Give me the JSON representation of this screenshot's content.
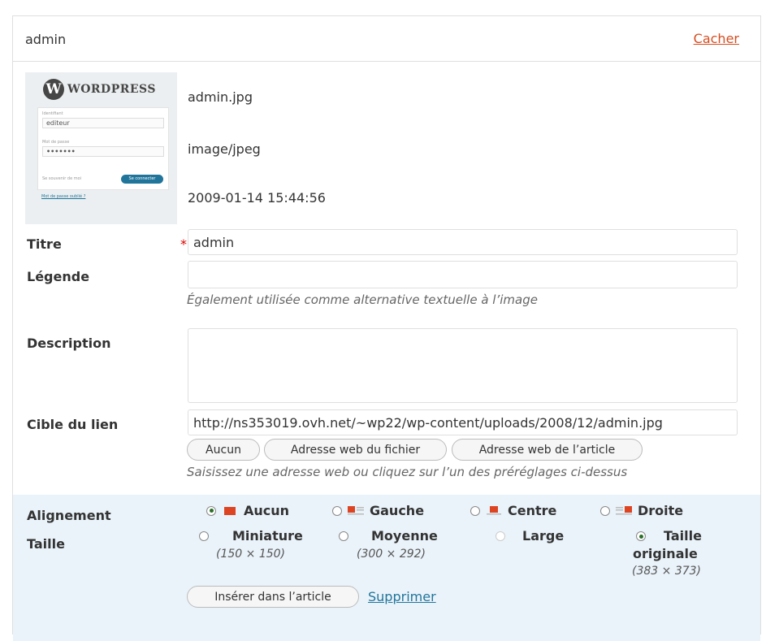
{
  "header": {
    "name": "admin",
    "hide_link": "Cacher"
  },
  "thumbnail": {
    "logo_text": "WordPress",
    "field1_label": "Identifiant",
    "field1_value": "editeur",
    "field2_label": "Mot de passe",
    "field2_value": "•••••••",
    "remember": "Se souvenir de moi",
    "login_button": "Se connecter",
    "lost_link": "Mot de passe oublié ?"
  },
  "meta": {
    "filename": "admin.jpg",
    "mime": "image/jpeg",
    "date": "2009-01-14 15:44:56"
  },
  "fields": {
    "title_label": "Titre",
    "title_value": "admin",
    "caption_label": "Légende",
    "caption_value": "",
    "caption_help": "Également utilisée comme alternative textuelle à l’image",
    "description_label": "Description",
    "description_value": "",
    "link_label": "Cible du lien",
    "link_value": "http://ns353019.ovh.net/~wp22/wp-content/uploads/2008/12/admin.jpg",
    "link_help": "Saisissez une adresse web ou cliquez sur l’un des préréglages ci-dessus"
  },
  "link_buttons": {
    "none": "Aucun",
    "file": "Adresse web du fichier",
    "post": "Adresse web de l’article"
  },
  "alignment": {
    "label": "Alignement",
    "options": [
      "Aucun",
      "Gauche",
      "Centre",
      "Droite"
    ],
    "selected": "Aucun"
  },
  "size": {
    "label": "Taille",
    "thumbnail": "Miniature",
    "thumbnail_dim": "(150 × 150)",
    "medium": "Moyenne",
    "medium_dim": "(300 × 292)",
    "large": "Large",
    "full_line1": "Taille",
    "full_line2": "originale",
    "full_dim": "(383 × 373)",
    "selected": "Taille originale"
  },
  "actions": {
    "insert": "Insérer dans l’article",
    "delete": "Supprimer"
  },
  "colors": {
    "accent_link": "#21759b",
    "hide_link": "#d54e21",
    "required": "#dd0000",
    "align_bg": "#eaf3fa"
  }
}
